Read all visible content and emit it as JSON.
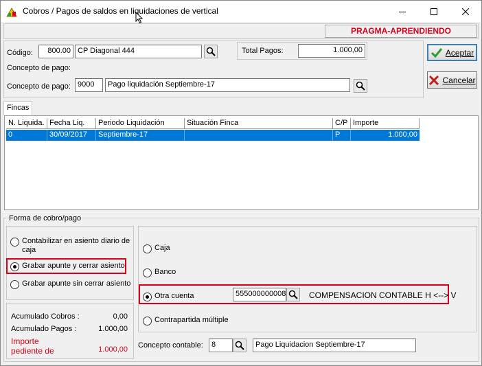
{
  "window": {
    "title": "Cobros / Pagos de saldos en liquidaciones de vertical",
    "status_banner": "PRAGMA-APRENDIENDO"
  },
  "form": {
    "codigo_label": "Código:",
    "codigo_value": "800.00",
    "codigo_desc": "CP Diagonal 444",
    "total_pagos_label": "Total Pagos:",
    "total_pagos_value": "1.000,00",
    "concepto_header": "Concepto de pago:",
    "concepto_label": "Concepto de pago:",
    "concepto_code": "9000",
    "concepto_desc": "Pago liquidación Septiembre-17"
  },
  "buttons": {
    "aceptar": "Aceptar",
    "cancelar": "Cancelar"
  },
  "tabs": [
    {
      "label": "Fincas"
    }
  ],
  "table": {
    "columns": [
      "N. Liquida.",
      "Fecha Liq.",
      "Periodo Liquidación",
      "Situación Finca",
      "C/P",
      "Importe"
    ],
    "rows": [
      [
        "0",
        "30/09/2017",
        "Septiembre-17",
        "",
        "P",
        "1.000,00"
      ]
    ]
  },
  "forma_cobro": {
    "group_label": "Forma de cobro/pago",
    "options": [
      {
        "label": "Contabilizar en asiento diario de caja",
        "selected": false
      },
      {
        "label": "Grabar apunte y cerrar asiento",
        "selected": true
      },
      {
        "label": "Grabar apunte sin cerrar asiento",
        "selected": false
      }
    ]
  },
  "acumulados": {
    "cobros_label": "Acumulado Cobros :",
    "cobros_value": "0,00",
    "pagos_label": "Acumulado Pagos :",
    "pagos_value": "1.000,00",
    "pendiente_label_1": "Importe",
    "pendiente_label_2": "pediente de",
    "pendiente_value": "1.000,00"
  },
  "cuenta": {
    "options": [
      {
        "label": "Caja",
        "selected": false
      },
      {
        "label": "Banco",
        "selected": false
      },
      {
        "label": "Otra cuenta",
        "selected": true
      },
      {
        "label": "Contrapartida múltiple",
        "selected": false
      }
    ],
    "otra_cuenta_value": "555000000008",
    "otra_cuenta_desc": "COMPENSACION CONTABLE H <--> V"
  },
  "concepto_contable": {
    "label": "Concepto contable:",
    "code": "8",
    "desc": "Pago Liquidacion Septiembre-17"
  },
  "colors": {
    "selection": "#0078d7",
    "highlight": "#d9001b",
    "accept_check": "#2e9e2e",
    "cancel_x": "#c0201b"
  },
  "icons": [
    "app-icon",
    "minimize-icon",
    "maximize-icon",
    "close-icon",
    "magnifier-icon",
    "check-icon",
    "x-icon"
  ]
}
